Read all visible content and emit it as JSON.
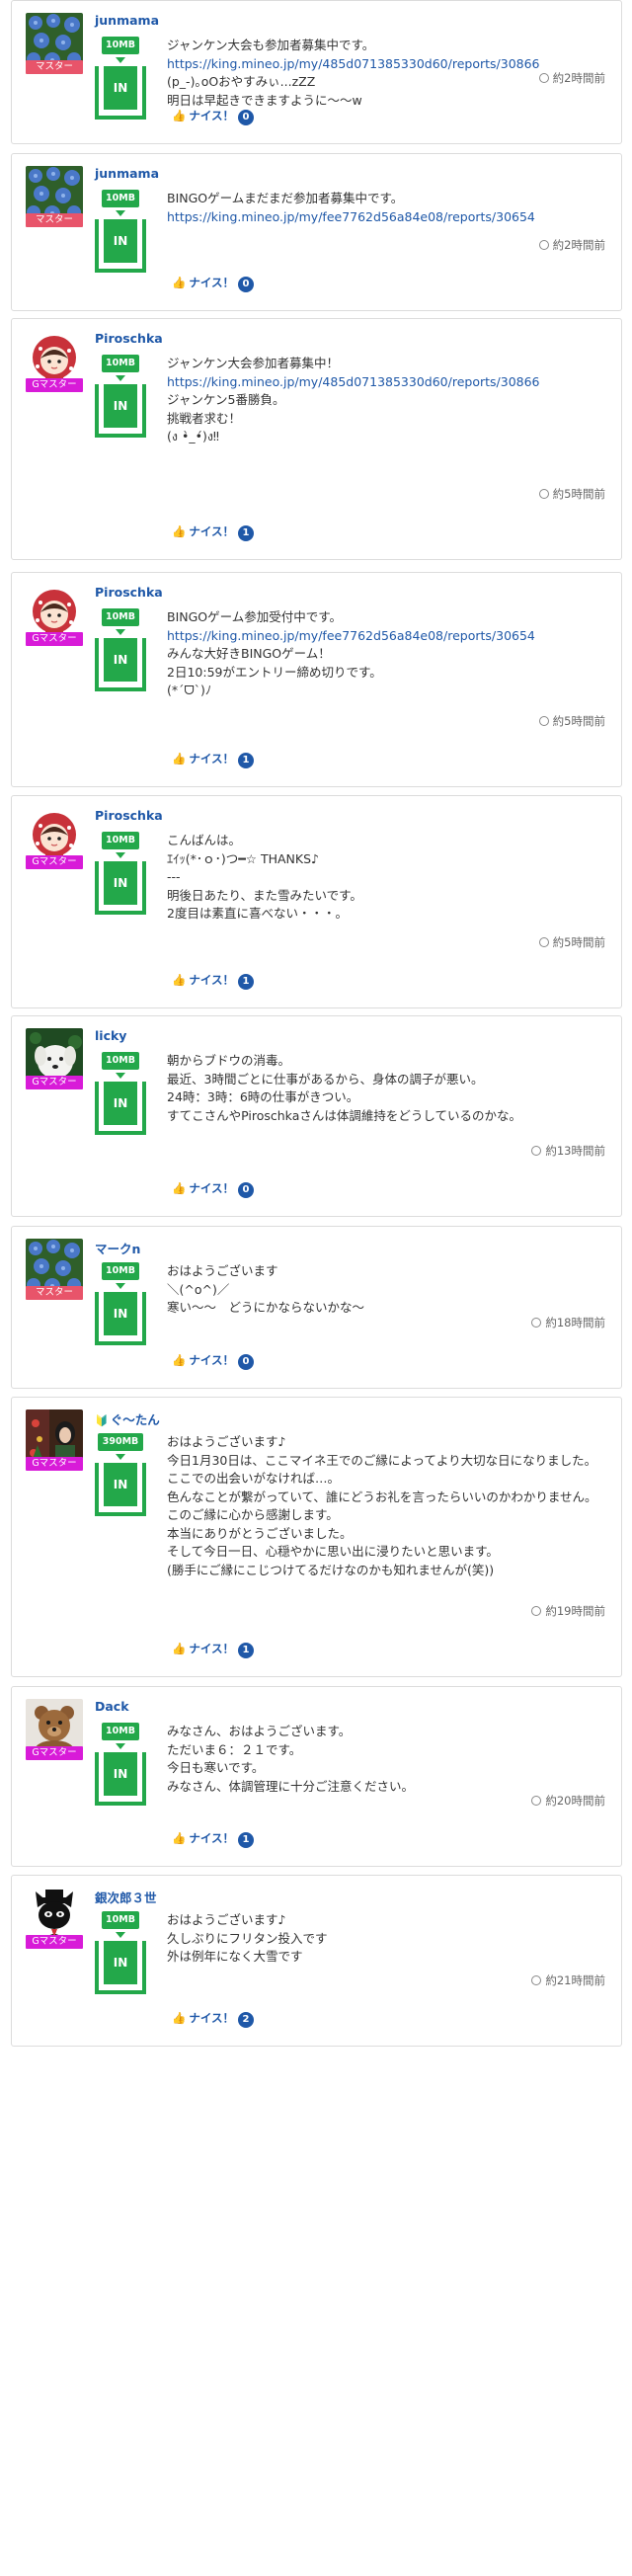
{
  "colors": {
    "link": "#1f58a8",
    "gift_green": "#23a84a",
    "master_badge": "#e8546a",
    "g_master_badge": "#d81bd8"
  },
  "posts": [
    {
      "id": 0,
      "user": "junmama",
      "role": "マスター",
      "role_type": "master",
      "avatar": "blue-flowers",
      "gift_amount": "10MB",
      "gift_label": "IN",
      "lines": [
        "ジャンケン大会も参加者募集中です。",
        "https://king.mineo.jp/my/485d071385330d60/reports/30866",
        "(p_-)｡oOおやすみぃ...zZZ",
        "明日は早起きできますように〜〜w"
      ],
      "link_index": 1,
      "time": "約2時間前",
      "nice_label": "ナイス！",
      "nice_count": "0"
    },
    {
      "id": 1,
      "user": "junmama",
      "role": "マスター",
      "role_type": "master",
      "avatar": "blue-flowers",
      "gift_amount": "10MB",
      "gift_label": "IN",
      "lines": [
        "BINGOゲームまだまだ参加者募集中です。",
        "https://king.mineo.jp/my/fee7762d56a84e08/reports/30654"
      ],
      "link_index": 1,
      "time": "約2時間前",
      "nice_label": "ナイス！",
      "nice_count": "0"
    },
    {
      "id": 2,
      "user": "Piroschka",
      "role": "Gマスター",
      "role_type": "g",
      "avatar": "red-hood-girl",
      "gift_amount": "10MB",
      "gift_label": "IN",
      "lines": [
        "ジャンケン大会参加者募集中！",
        "https://king.mineo.jp/my/485d071385330d60/reports/30866",
        "ジャンケン5番勝負。",
        "挑戦者求む！",
        "(ง •̀_•́)ง‼"
      ],
      "link_index": 1,
      "time": "約5時間前",
      "nice_label": "ナイス！",
      "nice_count": "1"
    },
    {
      "id": 3,
      "user": "Piroschka",
      "role": "Gマスター",
      "role_type": "g",
      "avatar": "red-hood-girl",
      "gift_amount": "10MB",
      "gift_label": "IN",
      "lines": [
        "BINGOゲーム参加受付中です。",
        "https://king.mineo.jp/my/fee7762d56a84e08/reports/30654",
        "みんな大好きBINGOゲーム！",
        "2日10:59がエントリー締め切りです。",
        "(*ˊᗜˋ)ﾉ"
      ],
      "link_index": 1,
      "time": "約5時間前",
      "nice_label": "ナイス！",
      "nice_count": "1"
    },
    {
      "id": 4,
      "user": "Piroschka",
      "role": "Gマスター",
      "role_type": "g",
      "avatar": "red-hood-girl",
      "gift_amount": "10MB",
      "gift_label": "IN",
      "lines": [
        "こんばんは。",
        "ｴｲｯ(*･ｏ･)つ━☆ THANKS♪",
        "---",
        "明後日あたり、また雪みたいです。",
        "2度目は素直に喜べない・・・。"
      ],
      "link_index": -1,
      "time": "約5時間前",
      "nice_label": "ナイス！",
      "nice_count": "1"
    },
    {
      "id": 5,
      "user": "licky",
      "role": "Gマスター",
      "role_type": "g",
      "avatar": "white-dog",
      "gift_amount": "10MB",
      "gift_label": "IN",
      "lines": [
        "朝からブドウの消毒。",
        "最近、3時間ごとに仕事があるから、身体の調子が悪い。",
        "24時：3時：6時の仕事がきつい。",
        "すてこさんやPiroschkaさんは体調維持をどうしているのかな。"
      ],
      "link_index": -1,
      "time": "約13時間前",
      "nice_label": "ナイス！",
      "nice_count": "0"
    },
    {
      "id": 6,
      "user": "マークn",
      "role": "マスター",
      "role_type": "master",
      "avatar": "blue-flowers",
      "gift_amount": "10MB",
      "gift_label": "IN",
      "lines": [
        "おはようございます",
        "＼(^o^)／",
        "寒い〜〜　どうにかならないかな〜"
      ],
      "link_index": -1,
      "time": "約18時間前",
      "nice_label": "ナイス！",
      "nice_count": "0"
    },
    {
      "id": 7,
      "user": "ぐ〜たん",
      "user_prefix": "🔰",
      "role": "Gマスター",
      "role_type": "g",
      "avatar": "christmas",
      "gift_amount": "390MB",
      "gift_label": "IN",
      "lines": [
        "おはようございます♪",
        "今日1月30日は、ここマイネ王でのご縁によってより大切な日になりました。",
        "ここでの出会いがなければ…。",
        "色んなことが繋がっていて、誰にどうお礼を言ったらいいのかわかりません。",
        "このご縁に心から感謝します。",
        "本当にありがとうございました。",
        "そして今日一日、心穏やかに思い出に浸りたいと思います。",
        "(勝手にご縁にこじつけてるだけなのかも知れませんが(笑))"
      ],
      "link_index": -1,
      "time": "約19時間前",
      "nice_label": "ナイス！",
      "nice_count": "1"
    },
    {
      "id": 8,
      "user": "Dack",
      "role": "Gマスター",
      "role_type": "g",
      "avatar": "teddy-bear",
      "gift_amount": "10MB",
      "gift_label": "IN",
      "lines": [
        "みなさん、おはようございます。",
        "ただいま６：２１です。",
        "今日も寒いです。",
        "みなさん、体調管理に十分ご注意ください。"
      ],
      "link_index": -1,
      "time": "約20時間前",
      "nice_label": "ナイス！",
      "nice_count": "1"
    },
    {
      "id": 9,
      "user": "銀次郎３世",
      "role": "Gマスター",
      "role_type": "g",
      "avatar": "black-cat",
      "gift_amount": "10MB",
      "gift_label": "IN",
      "lines": [
        "おはようございます♪",
        "久しぶりにフリタン投入です",
        "外は例年になく大雪です"
      ],
      "link_index": -1,
      "time": "約21時間前",
      "nice_label": "ナイス！",
      "nice_count": "2"
    }
  ]
}
